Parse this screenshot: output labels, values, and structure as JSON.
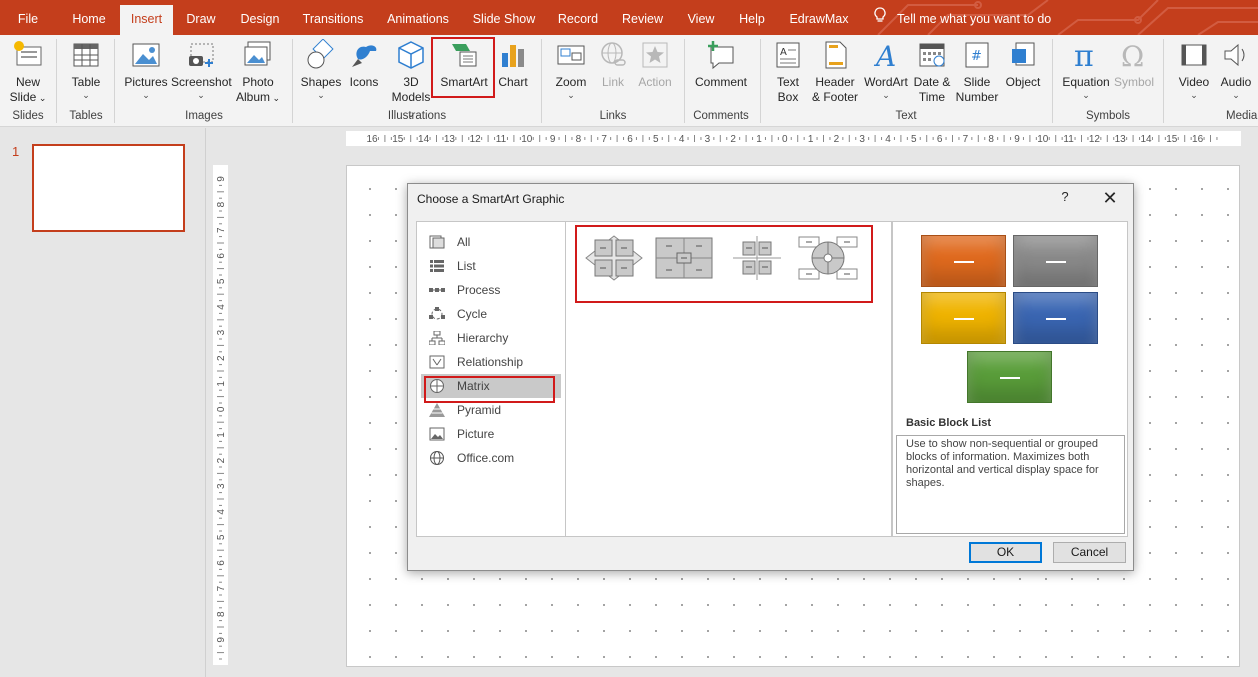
{
  "tabs": [
    "File",
    "Home",
    "Insert",
    "Draw",
    "Design",
    "Transitions",
    "Animations",
    "Slide Show",
    "Record",
    "Review",
    "View",
    "Help",
    "EdrawMax"
  ],
  "active_tab": "Insert",
  "tell_me": "Tell me what you want to do",
  "ribbon": {
    "new_slide": [
      "New",
      "Slide"
    ],
    "table": "Table",
    "pictures": "Pictures",
    "screenshot": "Screenshot",
    "photo_album": [
      "Photo",
      "Album"
    ],
    "shapes": "Shapes",
    "icons": "Icons",
    "models_3d": [
      "3D",
      "Models"
    ],
    "smartart": "SmartArt",
    "chart": "Chart",
    "zoom": "Zoom",
    "link": "Link",
    "action": "Action",
    "comment": "Comment",
    "text_box": [
      "Text",
      "Box"
    ],
    "header_footer": [
      "Header",
      "& Footer"
    ],
    "wordart": "WordArt",
    "date_time": [
      "Date &",
      "Time"
    ],
    "slide_number": [
      "Slide",
      "Number"
    ],
    "object": "Object",
    "equation": "Equation",
    "symbol": "Symbol",
    "video": "Video",
    "audio": "Audio",
    "groups": {
      "slides": "Slides",
      "tables": "Tables",
      "images": "Images",
      "illustrations": "Illustrations",
      "links": "Links",
      "comments": "Comments",
      "text": "Text",
      "symbols": "Symbols",
      "media": "Media"
    }
  },
  "thumbnail": {
    "slide_number": "1"
  },
  "rulers": {
    "horizontal": [
      "16",
      "15",
      "14",
      "13",
      "12",
      "11",
      "10",
      "9",
      "8",
      "7",
      "6",
      "5",
      "4",
      "3",
      "2",
      "1",
      "0",
      "1",
      "2",
      "3",
      "4",
      "5",
      "6",
      "7",
      "8",
      "9",
      "10",
      "11",
      "12",
      "13",
      "14",
      "15",
      "16"
    ],
    "vertical": [
      "9",
      "8",
      "7",
      "6",
      "5",
      "4",
      "3",
      "2",
      "1",
      "0",
      "1",
      "2",
      "3",
      "4",
      "5",
      "6",
      "7",
      "8",
      "9"
    ]
  },
  "dialog": {
    "title": "Choose a SmartArt Graphic",
    "help": "?",
    "close": "✕",
    "categories": [
      "All",
      "List",
      "Process",
      "Cycle",
      "Hierarchy",
      "Relationship",
      "Matrix",
      "Pyramid",
      "Picture",
      "Office.com"
    ],
    "selected_category": "Matrix",
    "layouts": [
      "Basic Matrix",
      "Titled Matrix",
      "Grid Matrix",
      "Cycle Matrix"
    ],
    "preview_colors": [
      "#e06a1e",
      "#8a8a8a",
      "#f0b400",
      "#3a66b3",
      "#5a9e3a"
    ],
    "preview_name": "Basic Block List",
    "preview_description": "Use to show non-sequential or grouped blocks of information. Maximizes both horizontal and vertical display space for shapes.",
    "ok": "OK",
    "cancel": "Cancel"
  }
}
